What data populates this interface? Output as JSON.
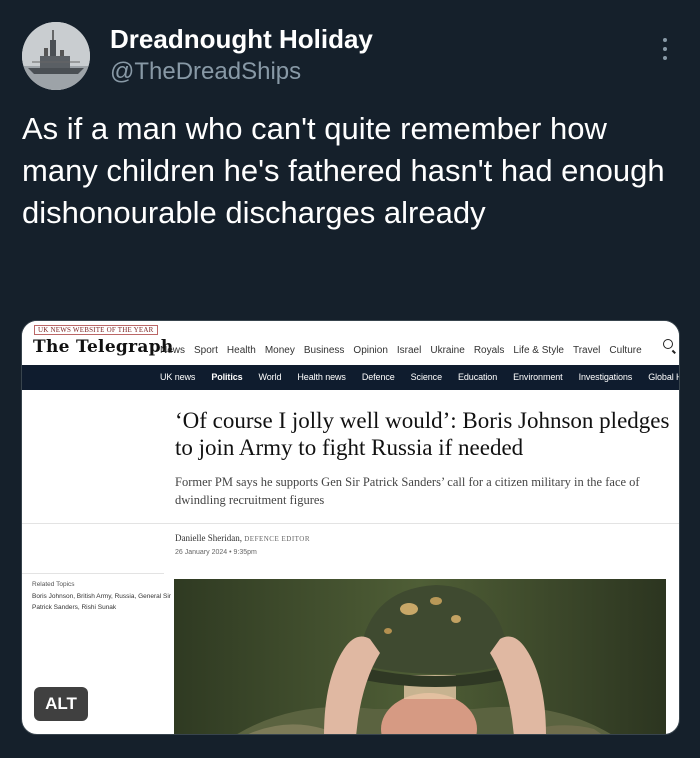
{
  "tweet": {
    "display_name": "Dreadnought Holiday",
    "handle": "@TheDreadShips",
    "text": "As if a man who can't quite remember how many children he's fathered hasn't had enough dishonourable discharges already"
  },
  "card": {
    "alt_label": "ALT",
    "telegraph": {
      "award": "UK NEWS WEBSITE OF THE YEAR",
      "masthead": "The Telegraph",
      "top_nav": [
        "News",
        "Sport",
        "Health",
        "Money",
        "Business",
        "Opinion",
        "Israel",
        "Ukraine",
        "Royals",
        "Life & Style",
        "Travel",
        "Culture"
      ],
      "sub_nav": [
        "UK news",
        "Politics",
        "World",
        "Health news",
        "Defence",
        "Science",
        "Education",
        "Environment",
        "Investigations",
        "Global Health Sec"
      ],
      "active_sub_nav": "Politics",
      "headline": "‘Of course I jolly well would’: Boris Johnson pledges to join Army to fight Russia if needed",
      "standfirst": "Former PM says he supports Gen Sir Patrick Sanders’ call for a citizen military in the face of dwindling recruitment figures",
      "author": "Danielle Sheridan,",
      "author_role": "Defence Editor",
      "date": "26 January 2024 • 9:35pm",
      "related_title": "Related Topics",
      "related_topics": "Boris Johnson, British Army, Russia, General Sir Patrick Sanders, Rishi Sunak"
    }
  },
  "colors": {
    "background": "#15202b",
    "secondary_text": "#8899a6",
    "telegraph_nav": "#0f1c2e"
  }
}
